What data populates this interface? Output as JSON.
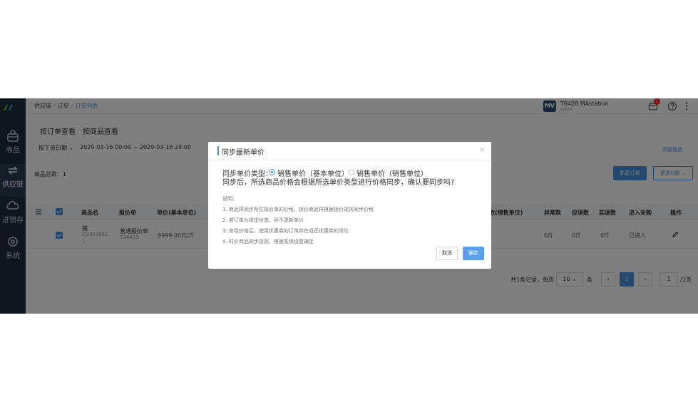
{
  "sidebar": {
    "items": [
      {
        "label": "商品",
        "icon": "bag-icon"
      },
      {
        "label": "供应链",
        "icon": "exchange-icon"
      },
      {
        "label": "进销存",
        "icon": "cloud-icon"
      },
      {
        "label": "系统",
        "icon": "gear-icon"
      }
    ]
  },
  "topbar": {
    "breadcrumb": [
      "供应链",
      "订单",
      "订单列表"
    ],
    "account_logo": "MV",
    "account_name": "T8428 MAstation",
    "account_sub": "sysv2",
    "notification_count": "1"
  },
  "main": {
    "tabs": [
      "按订单查看",
      "按商品查看"
    ],
    "date_filter_label": "按下单日期",
    "date_range": "2020-03-16 00:00 ~ 2020-03-16 24:00",
    "advanced_filter": "高级筛选",
    "total_label": "商品总数：",
    "total_value": "1",
    "new_order_button": "新建订单",
    "more_button": "更多功能",
    "table": {
      "headers": [
        "商品名",
        "报价单",
        "单价(基本单位)",
        "单价(销售单位)",
        "数(销售单位)",
        "异常数",
        "应退数",
        "实退数",
        "进入采购",
        "操作"
      ],
      "row": {
        "name": "猪",
        "code": "D2803661",
        "code2": "1",
        "quote": "普通报价单",
        "quote_code": "S34452",
        "price": "9999.00元/斤",
        "abnormal": "0斤",
        "refund_due": "0斤",
        "refund_actual": "0斤",
        "purchase": "已进入"
      }
    },
    "pager": {
      "summary": "共1条记录，每页",
      "per_page": "10",
      "unit": "条",
      "prev": "‹",
      "current": "1",
      "next": "›",
      "goto": "1",
      "total_pages": "/1页"
    }
  },
  "modal": {
    "title": "同步最新单价",
    "close": "×",
    "type_label": "同步单价类型：",
    "options": [
      "销售单价（基本单位）",
      "销售单价（销售单位）"
    ],
    "selected": 0,
    "confirm_text": "同步后，所选商品价格会根据所选单价类型进行价格同步，确认要同步吗?",
    "notes_title": "说明：",
    "notes": [
      "1. 商品将同步所在报价单的价格，锁价商品将根据锁价规则同步价格",
      "2. 若订单为锁定状态，则不更新单价",
      "3. 修改价格后，使用优惠券的订单存在退还优惠券的风险",
      "4. 时价商品同步规则，根据系统设置确定"
    ],
    "cancel_button": "取消",
    "ok_button": "确定"
  },
  "colors": {
    "accent": "#4a90e2",
    "sidebar_bg": "#1f2d3d"
  }
}
